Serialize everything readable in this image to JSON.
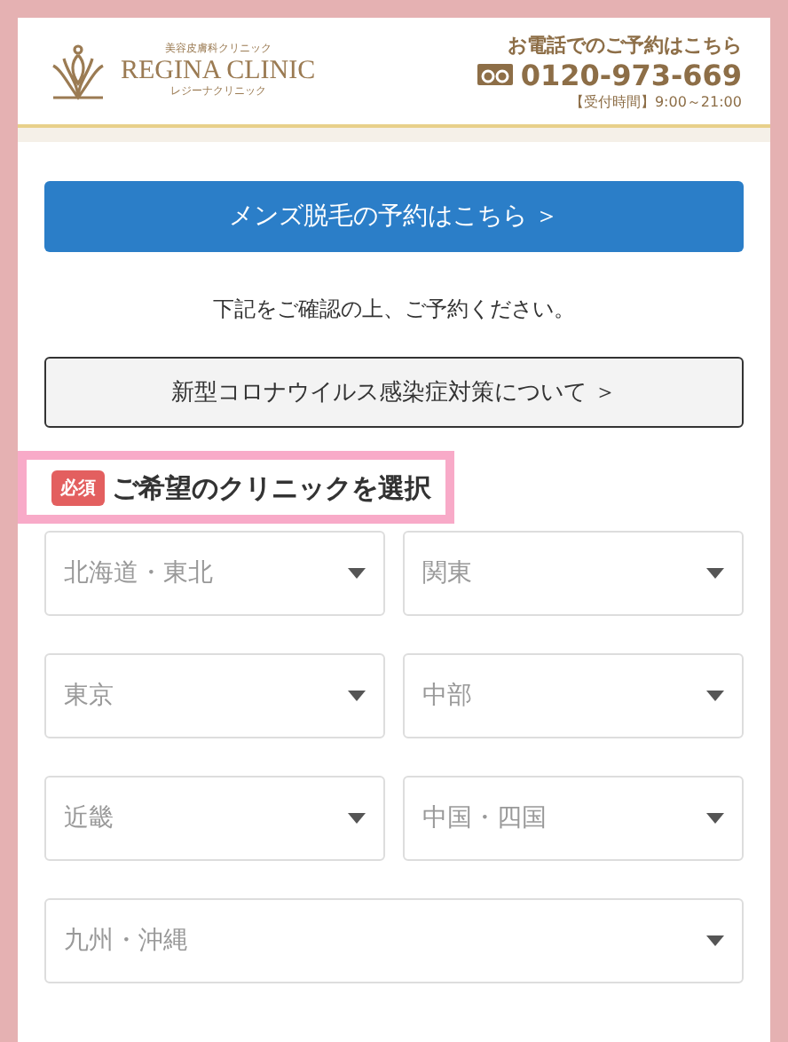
{
  "header": {
    "logo": {
      "subtitle": "美容皮膚科クリニック",
      "name": "REGINA CLINIC",
      "kana": "レジーナクリニック"
    },
    "phone": {
      "caption": "お電話でのご予約はこちら",
      "number": "0120-973-669",
      "hours": "【受付時間】9:00～21:00"
    }
  },
  "mens_button": "メンズ脱毛の予約はこちら ＞",
  "notice": "下記をご確認の上、ご予約ください。",
  "covid_button": "新型コロナウイルス感染症対策について ＞",
  "clinic_section": {
    "required_badge": "必須",
    "title": "ご希望のクリニックを選択",
    "highlighted": true,
    "selects": [
      {
        "placeholder": "北海道・東北",
        "wide": false
      },
      {
        "placeholder": "関東",
        "wide": false
      },
      {
        "placeholder": "東京",
        "wide": false
      },
      {
        "placeholder": "中部",
        "wide": false
      },
      {
        "placeholder": "近畿",
        "wide": false
      },
      {
        "placeholder": "中国・四国",
        "wide": false
      },
      {
        "placeholder": "九州・沖縄",
        "wide": true
      }
    ]
  }
}
